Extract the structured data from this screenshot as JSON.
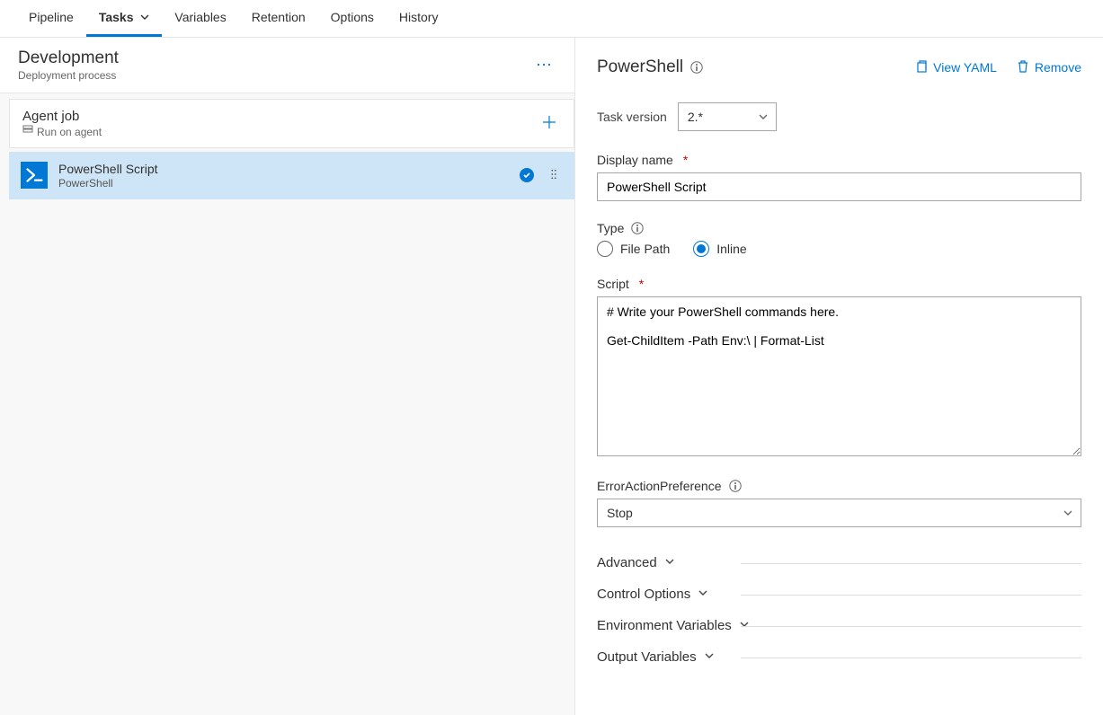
{
  "tabs": {
    "pipeline": "Pipeline",
    "tasks": "Tasks",
    "variables": "Variables",
    "retention": "Retention",
    "options": "Options",
    "history": "History"
  },
  "stage": {
    "title": "Development",
    "subtitle": "Deployment process"
  },
  "agent": {
    "title": "Agent job",
    "subtitle": "Run on agent"
  },
  "task": {
    "title": "PowerShell Script",
    "subtitle": "PowerShell"
  },
  "panel": {
    "title": "PowerShell",
    "viewYaml": "View YAML",
    "remove": "Remove",
    "taskVersionLabel": "Task version",
    "taskVersionValue": "2.*",
    "displayNameLabel": "Display name",
    "displayNameValue": "PowerShell Script",
    "typeLabel": "Type",
    "typeOptions": {
      "file": "File Path",
      "inline": "Inline"
    },
    "scriptLabel": "Script",
    "scriptValue": "# Write your PowerShell commands here.\n\nGet-ChildItem -Path Env:\\ | Format-List",
    "errorPrefLabel": "ErrorActionPreference",
    "errorPrefValue": "Stop",
    "sections": {
      "advanced": "Advanced",
      "control": "Control Options",
      "env": "Environment Variables",
      "out": "Output Variables"
    }
  }
}
